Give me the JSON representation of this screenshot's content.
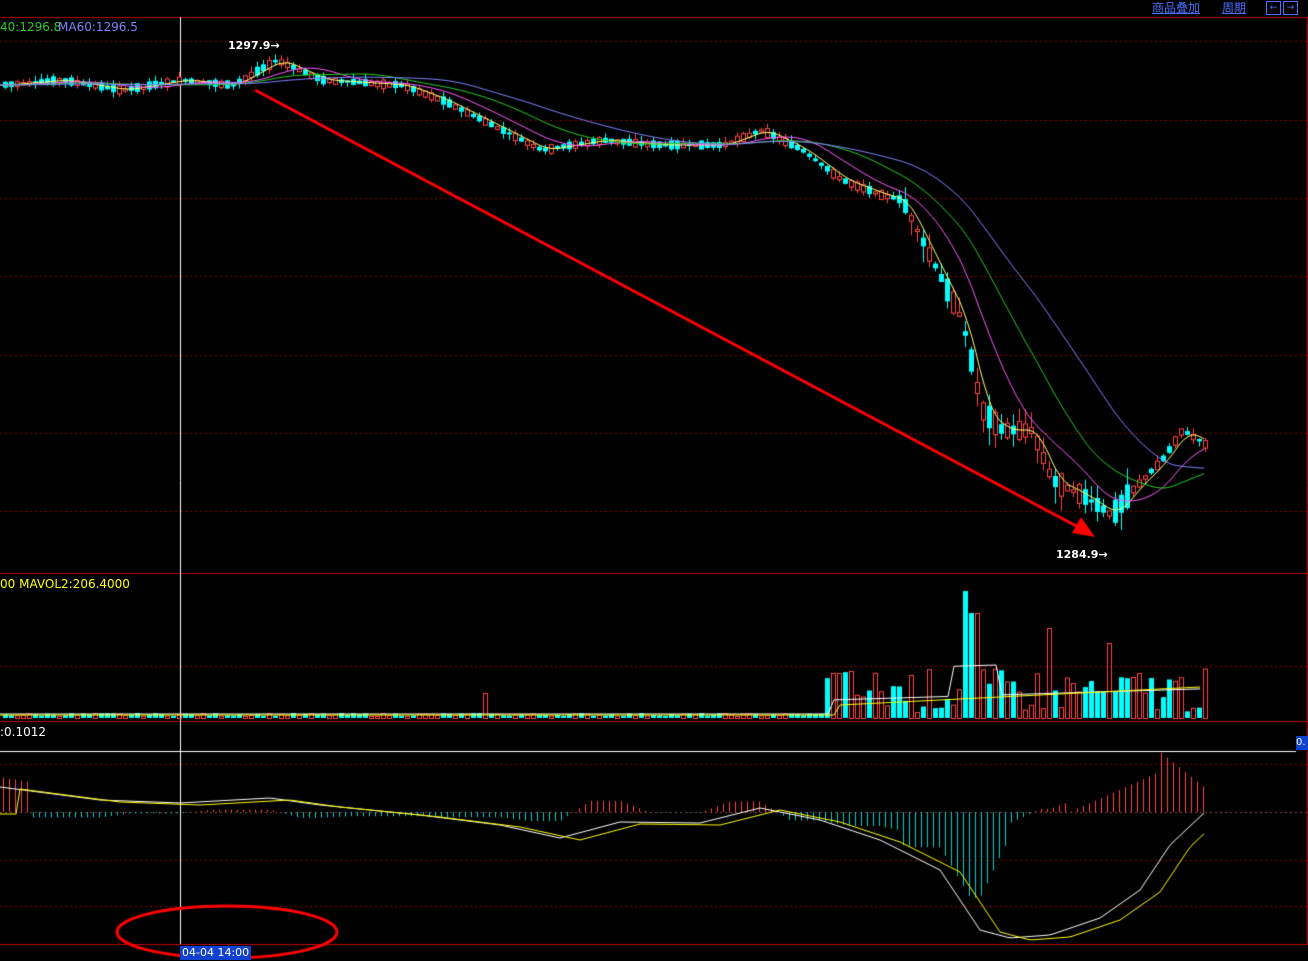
{
  "toolbar": {
    "overlay_label": "商品叠加",
    "period_label": "周期",
    "nav_left": "←",
    "nav_right": "→"
  },
  "main_panel": {
    "ma40_label": "40:1296.8",
    "ma60_label": "MA60:1296.5",
    "high_label": "1297.9",
    "low_label": "1284.9",
    "colors": {
      "ma40": "#22cc22",
      "ma60": "#8080ff"
    }
  },
  "volume_panel": {
    "mavol_label": "00 MAVOL2:206.4000",
    "mavol_color": "#ffff00"
  },
  "macd_panel": {
    "value_label": ":0.1012",
    "side_value": "0.",
    "date_label": "04-04 14:00"
  },
  "colors": {
    "up": "#ff4444",
    "down": "#00ffff",
    "gridline": "#aa0000",
    "crosshair": "#ffffff",
    "trend_arrow": "#ff0000"
  }
}
